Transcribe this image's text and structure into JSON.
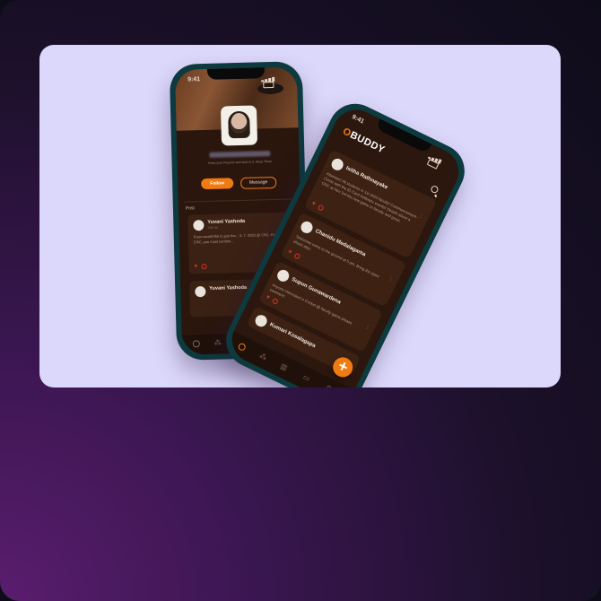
{
  "phone_profile": {
    "status_time": "9:41",
    "bio": "Keep your Passion and stick to it. Keep Them",
    "follow_label": "Follow",
    "message_label": "Message",
    "section_title": "Post",
    "posts": [
      {
        "name": "Yuvani Yashoda",
        "time": "2023 4th",
        "text": "If you would like to join the... 5. 7. 2023 @ CRC. Full day... CRC, you must confirm..."
      },
      {
        "name": "Yuvani Yashoda"
      }
    ],
    "tab_icons": [
      "home-icon",
      "community-icon",
      "map-icon",
      "chat-icon",
      "profile-icon"
    ]
  },
  "phone_feed": {
    "status_time": "9:41",
    "logo_prefix": "O",
    "logo_text": "BUDDY",
    "posts": [
      {
        "name": "Isitha Rathnayake",
        "text": "Attention! All students in 1st 2023 faculty! Commencement - Come with the ID Card Software events! Details about a CRC at Nov 3rd the new game to faculty and greet."
      },
      {
        "name": "Chanidu Medalagama",
        "text": "Tomorrow come to the ground at 5 pm. Bring the sport shoes also."
      },
      {
        "name": "Supun Gunawardena",
        "text": "Anyone interested in Cricket @ faculty game please comment"
      },
      {
        "name": "Kumari Kosalagapa"
      }
    ],
    "fab_label": "+",
    "tab_icons": [
      "home-icon",
      "community-icon",
      "map-icon",
      "chat-icon",
      "profile-icon"
    ]
  },
  "colors": {
    "accent": "#f07b12",
    "card_bg": "#dcd8fb",
    "app_bg": "#2b170d"
  }
}
